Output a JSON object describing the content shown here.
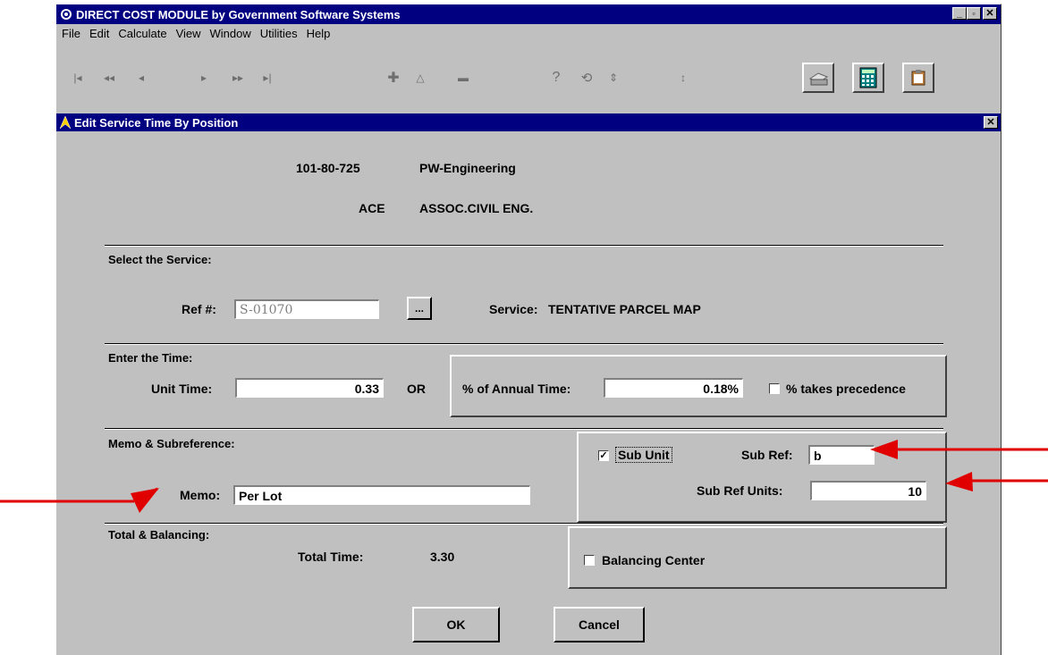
{
  "app": {
    "title": "DIRECT COST MODULE by Government Software Systems",
    "window_buttons": [
      "_",
      "🗗",
      "✕"
    ],
    "menu": [
      "File",
      "Edit",
      "Calculate",
      "View",
      "Window",
      "Utilities",
      "Help"
    ]
  },
  "toolbar": {
    "nav_icons": [
      "first-record-icon",
      "prev-page-icon",
      "prev-record-icon",
      "next-record-icon",
      "next-page-icon",
      "last-record-icon"
    ],
    "edit_icons": [
      "add-record-icon",
      "edit-record-icon",
      "delete-record-icon"
    ],
    "other_icons": [
      "help-icon",
      "refresh-icon",
      "expand-icon",
      "collapse-icon"
    ],
    "big_icons": [
      "printer-icon",
      "calculator-icon",
      "clipboard-icon"
    ]
  },
  "dialog": {
    "title": "Edit Service Time By Position",
    "dept_code": "101-80-725",
    "dept_name": "PW-Engineering",
    "position_code": "ACE",
    "position_name": "ASSOC.CIVIL ENG.",
    "select_service": {
      "heading": "Select the Service:",
      "ref_label": "Ref #:",
      "ref_value": "S-01070",
      "browse_label": "...",
      "service_label": "Service:",
      "service_value": "TENTATIVE PARCEL MAP"
    },
    "time": {
      "heading": "Enter the Time:",
      "unit_time_label": "Unit Time:",
      "unit_time_value": "0.33",
      "or_label": "OR",
      "annual_label": "% of Annual Time:",
      "annual_value": "0.18%",
      "precedence_label": "% takes precedence",
      "precedence_checked": false
    },
    "memo": {
      "heading": "Memo & Subreference:",
      "memo_label": "Memo:",
      "memo_value": "Per Lot",
      "sub_unit_label": "Sub Unit",
      "sub_unit_checked": true,
      "sub_ref_label": "Sub Ref:",
      "sub_ref_value": "b",
      "sub_ref_units_label": "Sub Ref Units:",
      "sub_ref_units_value": "10"
    },
    "total": {
      "heading": "Total & Balancing:",
      "total_label": "Total Time:",
      "total_value": "3.30",
      "balancing_label": "Balancing Center",
      "balancing_checked": false
    },
    "ok_label": "OK",
    "cancel_label": "Cancel"
  },
  "annotations": {
    "arrow_color": "#e00000"
  }
}
